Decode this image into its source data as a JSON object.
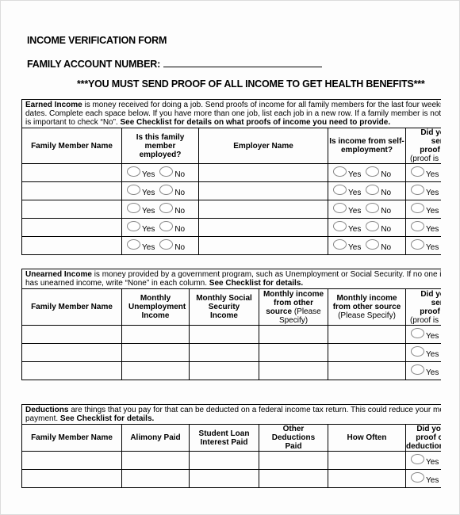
{
  "header": {
    "title": "INCOME VERIFICATION FORM",
    "account_label": "FAMILY ACCOUNT NUMBER:",
    "notice": "***YOU MUST SEND PROOF OF ALL INCOME TO GET HEALTH BENEFITS***"
  },
  "radio": {
    "yes": "Yes",
    "no": "No"
  },
  "earned": {
    "intro_bold": "Earned Income",
    "intro_line1": " is money received for doing a job. Send proofs of income for all family members for the last four weeks: in",
    "intro_line2": "dates. Complete each space below. If you have more than one job, list each job in a new row. If a family member is not em",
    "intro_line3": "is important to check “No”.  ",
    "intro_line3_bold": "See Checklist for details on what proofs of income you need to provide.",
    "columns": [
      "Family Member Name",
      "Is this family member employed?",
      "Employer Name",
      "Is income from self-employment?",
      "Did you send proof of",
      "(proof is"
    ],
    "rows": [
      {
        "name": "",
        "employer": ""
      },
      {
        "name": "",
        "employer": ""
      },
      {
        "name": "",
        "employer": ""
      },
      {
        "name": "",
        "employer": ""
      },
      {
        "name": "",
        "employer": ""
      }
    ]
  },
  "unearned": {
    "intro_bold": "Unearned Income",
    "intro_line1": " is money provided by a government program, such as Unemployment or Social Security. If no one in yo",
    "intro_line2": "has unearned income, write “None” in each column. ",
    "intro_line2_bold": "See Checklist for details.",
    "columns": [
      "Family Member Name",
      "Monthly Unemployment Income",
      "Monthly Social Security Income",
      "Monthly income from other",
      "source",
      "(Please Specify)",
      "Monthly income from other source",
      "(Please Specify)",
      "Did you send proof of",
      "(proof is"
    ],
    "rows": [
      {
        "name": "",
        "unemployment": "",
        "social_security": "",
        "other1": "",
        "other2": ""
      },
      {
        "name": "",
        "unemployment": "",
        "social_security": "",
        "other1": "",
        "other2": ""
      },
      {
        "name": "",
        "unemployment": "",
        "social_security": "",
        "other1": "",
        "other2": ""
      }
    ]
  },
  "deductions": {
    "intro_bold": "Deductions",
    "intro_line1": " are things that you pay for that can be deducted on a federal income tax return. This could reduce your month",
    "intro_line2": "payment. ",
    "intro_line2_bold": "See Checklist for details.",
    "columns": [
      "Family Member Name",
      "Alimony Paid",
      "Student Loan Interest Paid",
      "Other Deductions Paid",
      "How Often",
      "Did you",
      "proof of",
      "deductions"
    ],
    "rows": [
      {
        "name": "",
        "alimony": "",
        "student_loan": "",
        "other": "",
        "how_often": ""
      },
      {
        "name": "",
        "alimony": "",
        "student_loan": "",
        "other": "",
        "how_often": ""
      }
    ]
  }
}
